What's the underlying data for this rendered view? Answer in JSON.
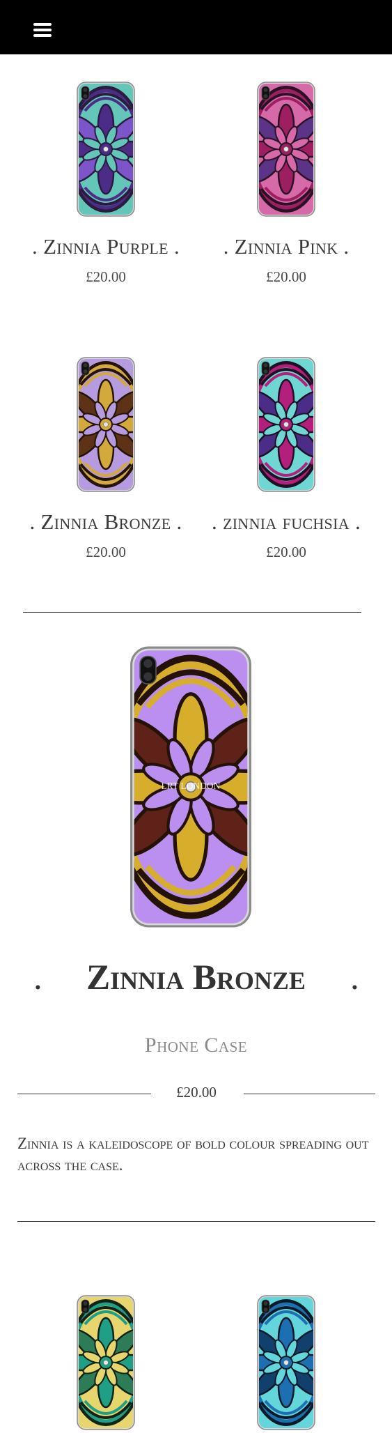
{
  "header": {
    "menu_icon": "hamburger-menu-icon"
  },
  "related_top": [
    {
      "title": ". Zinnia Purple .",
      "price": "£20.00",
      "palette": [
        "#4b2c86",
        "#63c6b8",
        "#7c56c9",
        "#2b1b3f"
      ]
    },
    {
      "title": ". Zinnia Pink .",
      "price": "£20.00",
      "palette": [
        "#9d1f62",
        "#d66aa9",
        "#5b3487",
        "#2a1226"
      ]
    },
    {
      "title": ". Zinnia Bronze .",
      "price": "£20.00",
      "palette": [
        "#d2a93a",
        "#b79be0",
        "#5d3216",
        "#241406"
      ]
    },
    {
      "title": ". zinnia fuchsia .",
      "price": "£20.00",
      "palette": [
        "#b31f7b",
        "#6ed7d4",
        "#4b2c86",
        "#1e1025"
      ]
    }
  ],
  "product": {
    "title": "Zinnia Bronze",
    "subtitle": "Phone Case",
    "price": "£20.00",
    "description": "Zinnia is a kaleidoscope of bold colour spreading out across the case.",
    "brand_mark": "LRT LONDON",
    "palette": [
      "#d6ae2c",
      "#bb8ff0",
      "#5e2218",
      "#231205"
    ]
  },
  "related_bottom": [
    {
      "palette": [
        "#1f9f86",
        "#e7d66e",
        "#2c7c58",
        "#122315"
      ]
    },
    {
      "palette": [
        "#1c6fb0",
        "#62d6db",
        "#11406c",
        "#0b1a28"
      ]
    }
  ]
}
